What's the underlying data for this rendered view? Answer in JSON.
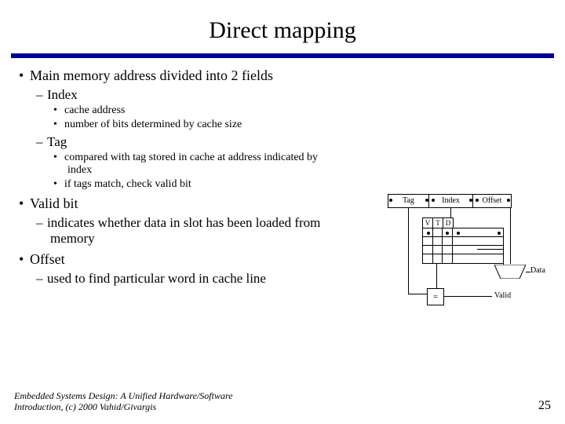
{
  "title": "Direct mapping",
  "bullets": {
    "main1": "Main memory address divided into 2 fields",
    "index": "Index",
    "index_a": "cache address",
    "index_b": "number of bits determined by cache size",
    "tag": "Tag",
    "tag_a": "compared with tag stored in cache at address indicated by index",
    "tag_b": "if tags match, check valid bit",
    "valid": "Valid bit",
    "valid_a": "indicates whether data in slot has been loaded from memory",
    "offset": "Offset",
    "offset_a": "used to find particular word in cache line"
  },
  "diagram": {
    "addr": {
      "tag": "Tag",
      "index": "Index",
      "offset": "Offset"
    },
    "vtd": {
      "v": "V",
      "t": "T",
      "d": "D"
    },
    "data": "Data",
    "cmp": "=",
    "valid": "Valid"
  },
  "footer": {
    "source": "Embedded Systems Design: A Unified Hardware/Software Introduction, (c) 2000 Vahid/Givargis",
    "page": "25"
  }
}
